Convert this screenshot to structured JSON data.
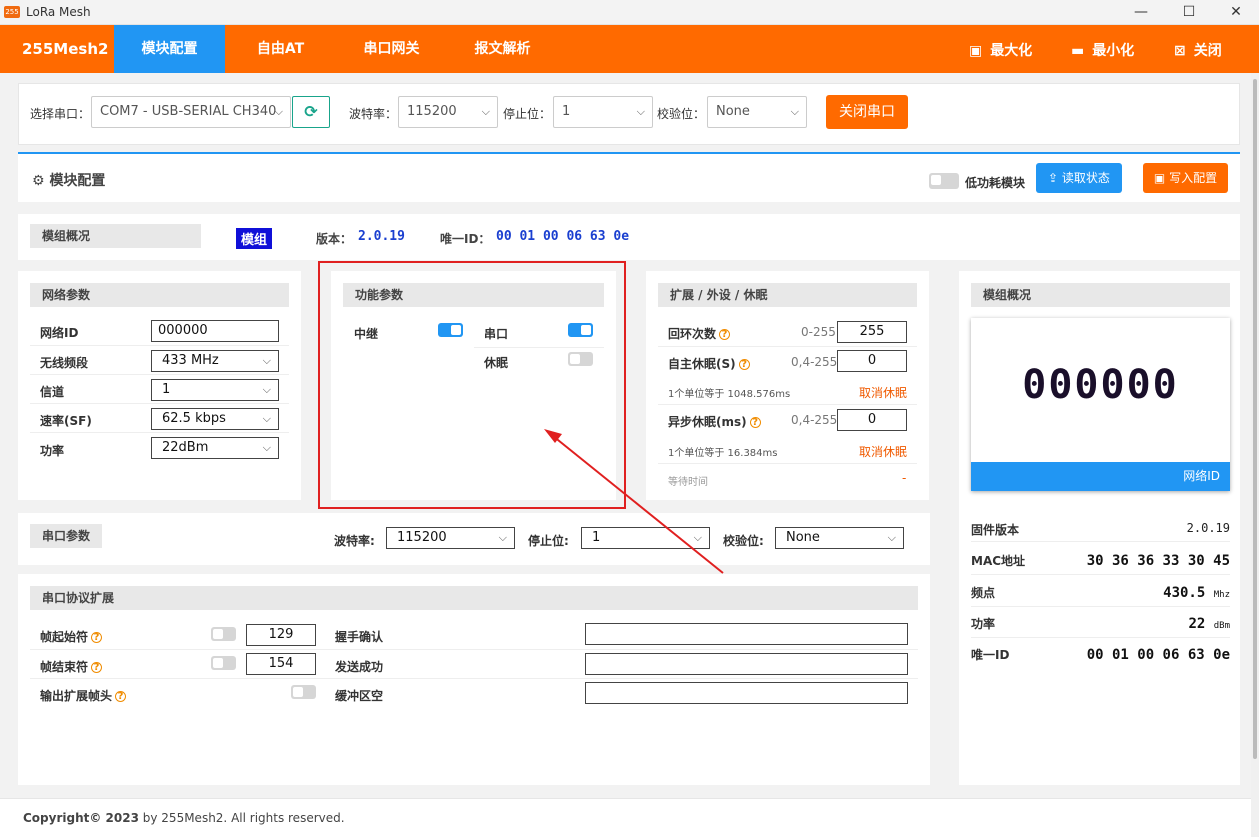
{
  "window": {
    "title": "LoRa Mesh",
    "icon_text": "255",
    "controls": [
      "minimize-icon",
      "maximize-icon",
      "close-icon"
    ]
  },
  "nav": {
    "brand": "255Mesh2",
    "tabs": [
      {
        "label": "模块配置",
        "active": true
      },
      {
        "label": "自由AT"
      },
      {
        "label": "串口网关"
      },
      {
        "label": "报文解析"
      }
    ],
    "right": [
      {
        "label": "最大化",
        "icon": "window-maximize-icon"
      },
      {
        "label": "最小化",
        "icon": "window-minimize-icon"
      },
      {
        "label": "关闭",
        "icon": "window-close-icon"
      }
    ]
  },
  "serial": {
    "port_label": "选择串口：",
    "port_value": "COM7 - USB-SERIAL CH340",
    "baud_label": "波特率：",
    "baud_value": "115200",
    "stop_label": "停止位：",
    "stop_value": "1",
    "parity_label": "校验位：",
    "parity_value": "None",
    "close_button": "关闭串口"
  },
  "module": {
    "title": "模块配置",
    "low_power_label": "低功耗模块",
    "read_button": "读取状态",
    "write_button": "写入配置"
  },
  "overview": {
    "label": "模组概况",
    "badge": "模组",
    "version_label": "版本：",
    "version": "2.0.19",
    "uid_label": "唯一ID：",
    "uid": "00 01 00 06 63 0e"
  },
  "network": {
    "header": "网络参数",
    "rows": [
      {
        "label": "网络ID",
        "value": "000000",
        "type": "input"
      },
      {
        "label": "无线频段",
        "value": "433 MHz",
        "type": "select"
      },
      {
        "label": "信道",
        "value": "1",
        "type": "select"
      },
      {
        "label": "速率(SF)",
        "value": "62.5 kbps",
        "type": "select"
      },
      {
        "label": "功率",
        "value": "22dBm",
        "type": "select"
      }
    ]
  },
  "function": {
    "header": "功能参数",
    "relay_label": "中继",
    "relay_on": true,
    "serial_label": "串口",
    "serial_on": true,
    "sleep_label": "休眠",
    "sleep_on": false
  },
  "ext": {
    "header": "扩展 / 外设 / 休眠",
    "loop_label": "回环次数",
    "loop_range": "0-255",
    "loop_value": "255",
    "self_sleep_label": "自主休眠(S)",
    "self_sleep_range": "0,4-255",
    "self_sleep_value": "0",
    "self_sleep_note": "1个单位等于 1048.576ms",
    "cancel1": "取消休眠",
    "async_sleep_label": "异步休眠(ms)",
    "async_sleep_range": "0,4-255",
    "async_sleep_value": "0",
    "async_sleep_note": "1个单位等于 16.384ms",
    "cancel2": "取消休眠",
    "wait_label": "等待时间",
    "wait_value": "-"
  },
  "side": {
    "header": "模组概况",
    "net_id": "000000",
    "net_id_caption": "网络ID",
    "firmware_label": "固件版本",
    "firmware": "2.0.19",
    "mac_label": "MAC地址",
    "mac": "30 36 36 33 30 45",
    "freq_label": "频点",
    "freq": "430.5",
    "freq_unit": "Mhz",
    "power_label": "功率",
    "power": "22",
    "power_unit": "dBm",
    "uid_label": "唯一ID",
    "uid": "00 01 00 06 63 0e"
  },
  "uart": {
    "header": "串口参数",
    "baud_label": "波特率:",
    "baud": "115200",
    "stop_label": "停止位:",
    "stop": "1",
    "parity_label": "校验位:",
    "parity": "None"
  },
  "protocol": {
    "header": "串口协议扩展",
    "start_label": "帧起始符",
    "start_value": "129",
    "end_label": "帧结束符",
    "end_value": "154",
    "ext_label": "输出扩展帧头",
    "handshake_label": "握手确认",
    "sent_label": "发送成功",
    "buffer_label": "缓冲区空"
  },
  "footer": {
    "copy": "Copyright© 2023",
    "rest": " by 255Mesh2. All rights reserved."
  },
  "colors": {
    "accent": "#ff6a00",
    "blue": "#2196f3",
    "highlight_box": "#e02020"
  }
}
